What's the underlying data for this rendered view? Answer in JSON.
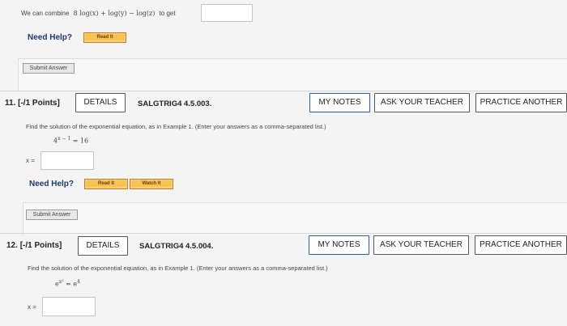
{
  "top": {
    "combine_text": "We can combine",
    "expression": "8 log(x) + log(y) − log(z)",
    "to_get": "to get",
    "need_help": "Need Help?",
    "read_it": "Read It",
    "submit": "Submit Answer"
  },
  "q11": {
    "number": "11.",
    "points": "[-/1 Points]",
    "details": "DETAILS",
    "code": "SALGTRIG4 4.5.003.",
    "my_notes": "MY NOTES",
    "ask_teacher": "ASK YOUR TEACHER",
    "practice": "PRACTICE ANOTHER",
    "question": "Find the solution of the exponential equation, as in Example 1. (Enter your answers as a comma-separated list.)",
    "equation_base": "4",
    "equation_exp": "x − 1",
    "equation_rhs": "= 16",
    "x_label": "x =",
    "need_help": "Need Help?",
    "read_it": "Read It",
    "watch_it": "Watch It",
    "submit": "Submit Answer"
  },
  "q12": {
    "number": "12.",
    "points": "[-/1 Points]",
    "details": "DETAILS",
    "code": "SALGTRIG4 4.5.004.",
    "my_notes": "MY NOTES",
    "ask_teacher": "ASK YOUR TEACHER",
    "practice": "PRACTICE ANOTHER",
    "question": "Find the solution of the exponential equation, as in Example 1. (Enter your answers as a comma-separated list.)",
    "equation_lhs_base": "e",
    "equation_lhs_exp": "x²",
    "equation_eq": "=",
    "equation_rhs_base": "e",
    "equation_rhs_exp": "4",
    "x_label": "x ="
  }
}
